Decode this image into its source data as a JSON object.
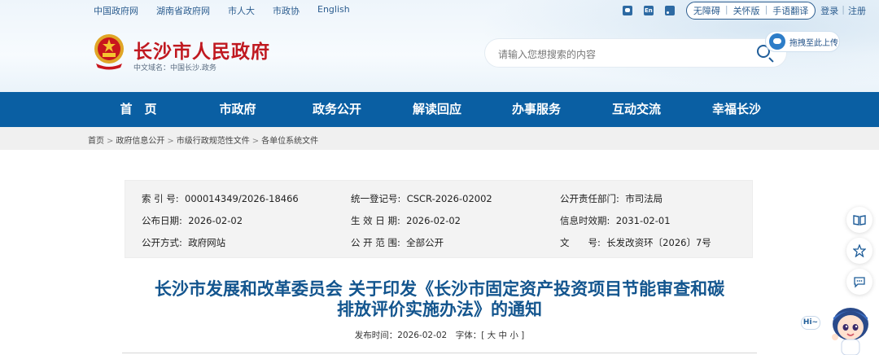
{
  "top_links": [
    "中国政府网",
    "湖南省政府网",
    "市人大",
    "市政协",
    "English"
  ],
  "top_right": {
    "accessibility": "无障碍",
    "care_version": "关怀版",
    "sign_language": "手语翻译",
    "login": "登录",
    "register": "注册",
    "en_icon_text": "En"
  },
  "site": {
    "title": "长沙市人民政府",
    "domain": "中文域名：中国长沙.政务"
  },
  "search": {
    "placeholder": "请输入您想搜索的内容",
    "upload_label": "拖拽至此上传"
  },
  "nav": [
    "首　页",
    "市政府",
    "政务公开",
    "解读回应",
    "办事服务",
    "互动交流",
    "幸福长沙"
  ],
  "breadcrumbs": [
    "首页",
    "政府信息公开",
    "市级行政规范性文件",
    "各单位系统文件"
  ],
  "info": {
    "index_label": "索 引 号:",
    "index_value": "000014349/2026-18466",
    "reg_label": "统一登记号:",
    "reg_value": "CSCR-2026-02002",
    "dept_label": "公开责任部门:",
    "dept_value": "市司法局",
    "pub_label": "公布日期:",
    "pub_value": "2026-02-02",
    "eff_label": "生 效 日 期:",
    "eff_value": "2026-02-02",
    "valid_label": "信息时效期:",
    "valid_value": "2031-02-01",
    "way_label": "公开方式:",
    "way_value": "政府网站",
    "scope_label": "公 开 范 围:",
    "scope_value": "全部公开",
    "doc_label": "文　　号:",
    "doc_value": "长发改资环〔2026〕7号"
  },
  "article": {
    "title_line1": "长沙市发展和改革委员会 关于印发《长沙市固定资产投资项目节能审查和碳",
    "title_line2": "排放评价实施办法》的通知",
    "meta": "发布时间：2026-02-02　字体：[ 大 中 小 ]"
  },
  "assistant": {
    "greeting": "Hi~"
  },
  "colors": {
    "nav_bg": "#0a5fa3",
    "title_blue": "#13558e",
    "site_red": "#c01920"
  }
}
